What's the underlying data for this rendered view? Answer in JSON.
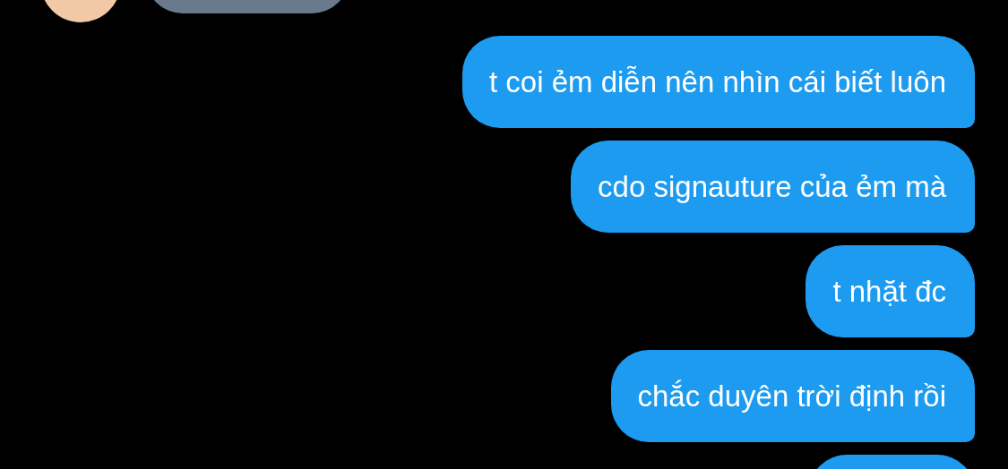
{
  "messages": [
    {
      "kind": "received"
    },
    {
      "kind": "sent",
      "text": "t coi ẻm diễn nên nhìn cái biết luôn"
    },
    {
      "kind": "sent",
      "text": "cdo signauture của ẻm mà"
    },
    {
      "kind": "sent",
      "text": "t nhặt đc"
    },
    {
      "kind": "sent",
      "text": "chắc duyên trời định rồi"
    },
    {
      "kind": "sent"
    }
  ]
}
